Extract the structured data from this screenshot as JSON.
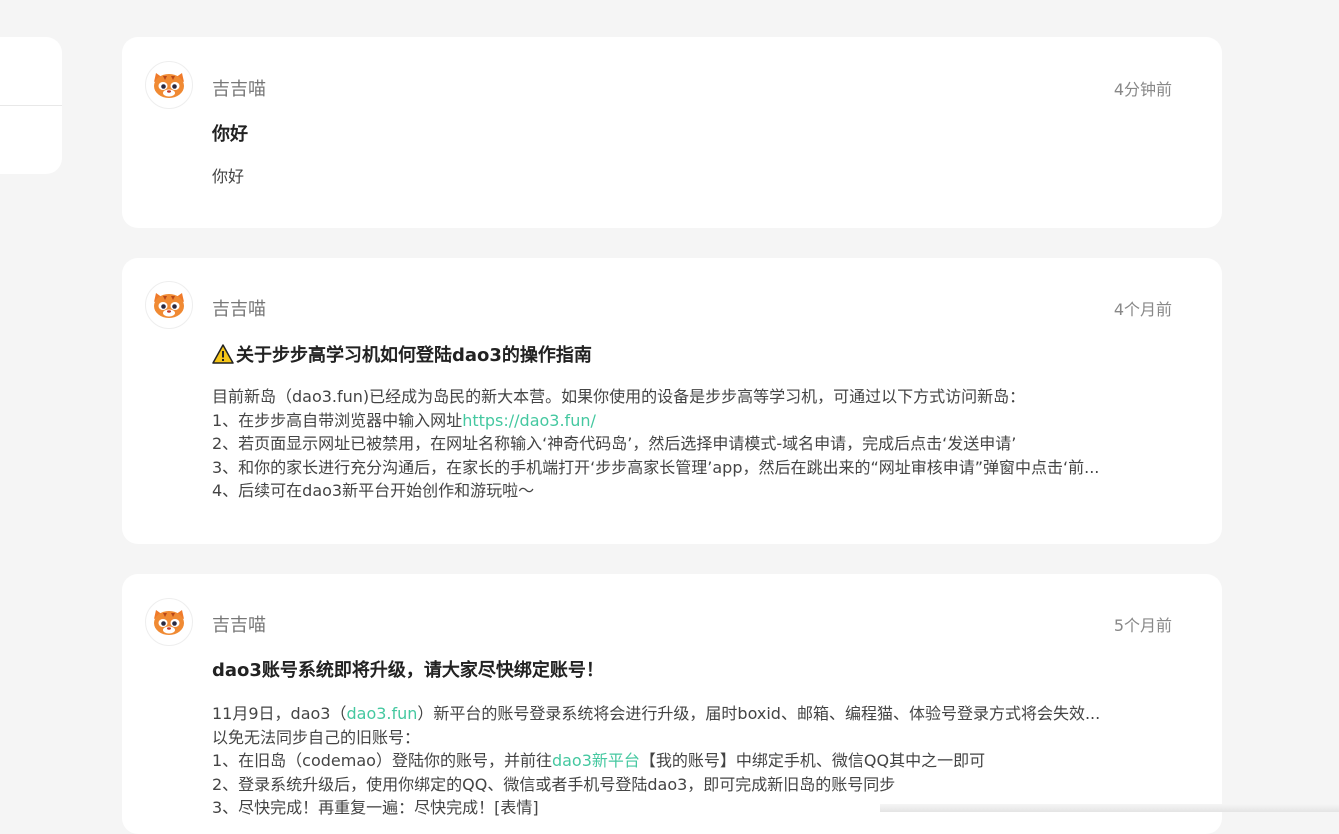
{
  "posts": [
    {
      "author": "吉吉喵",
      "time": "4分钟前",
      "title": "你好",
      "body": [
        "你好"
      ]
    },
    {
      "author": "吉吉喵",
      "time": "4个月前",
      "title_icon": "warning-icon",
      "title": "关于步步高学习机如何登陆dao3的操作指南",
      "line1": "目前新岛（dao3.fun)已经成为岛民的新大本营。如果你使用的设备是步步高等学习机，可通过以下方式访问新岛：",
      "line2_prefix": "1、在步步高自带浏览器中输入网址",
      "line2_link": "https://dao3.fun/",
      "line3": "2、若页面显示网址已被禁用，在网址名称输入‘神奇代码岛’，然后选择申请模式-域名申请，完成后点击‘发送申请’",
      "line4": "3、和你的家长进行充分沟通后，在家长的手机端打开‘步步高家长管理’app，然后在跳出来的“网址审核申请”弹窗中点击‘前...",
      "line5": "4、后续可在dao3新平台开始创作和游玩啦～"
    },
    {
      "author": "吉吉喵",
      "time": "5个月前",
      "title": "dao3账号系统即将升级，请大家尽快绑定账号！",
      "line1_prefix": "11月9日，dao3（",
      "line1_link": "dao3.fun",
      "line1_suffix": "）新平台的账号登录系统将会进行升级，届时boxid、邮箱、编程猫、体验号登录方式将会失效...",
      "line2": "以免无法同步自己的旧账号：",
      "line3_prefix": "1、在旧岛（codemao）登陆你的账号，并前往",
      "line3_link": "dao3新平台",
      "line3_suffix": "【我的账号】中绑定手机、微信QQ其中之一即可",
      "line4": "2、登录系统升级后，使用你绑定的QQ、微信或者手机号登陆dao3，即可完成新旧岛的账号同步",
      "line5": "3、尽快完成！再重复一遍：尽快完成！[表情]"
    }
  ],
  "colors": {
    "link": "#45c8a0",
    "background": "#f5f5f5",
    "card": "#ffffff"
  },
  "avatar_icon": "tiger-mascot-icon"
}
